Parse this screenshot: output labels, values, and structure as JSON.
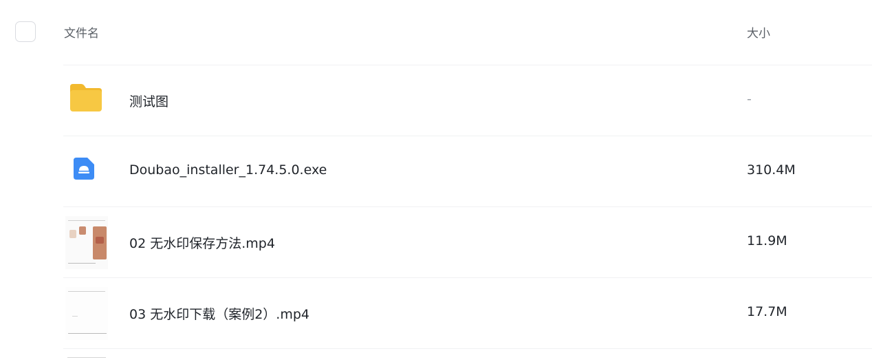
{
  "header": {
    "name_column": "文件名",
    "size_column": "大小"
  },
  "files": [
    {
      "name": "测试图",
      "size": "-",
      "type": "folder",
      "icon": "folder-icon"
    },
    {
      "name": "Doubao_installer_1.74.5.0.exe",
      "size": "310.4M",
      "type": "exe",
      "icon": "exe-icon"
    },
    {
      "name": "02 无水印保存方法.mp4",
      "size": "11.9M",
      "type": "video",
      "icon": "video-thumbnail"
    },
    {
      "name": "03 无水印下载（案例2）.mp4",
      "size": "17.7M",
      "type": "video",
      "icon": "video-thumbnail"
    }
  ],
  "colors": {
    "folder": "#f7c843",
    "exe": "#3d8cf5",
    "divider": "#f0f1f3"
  }
}
